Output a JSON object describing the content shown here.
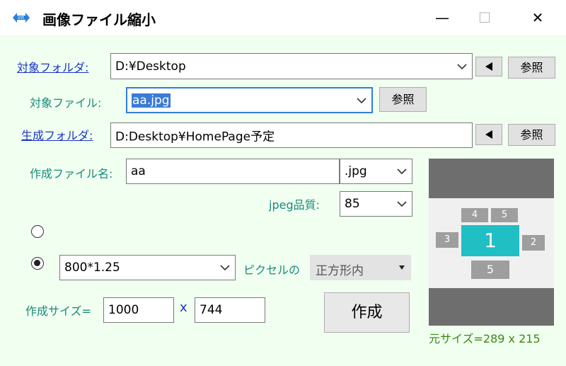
{
  "window": {
    "title": "画像ファイル縮小",
    "minimize": "—",
    "maximize": "☐",
    "close": "✕"
  },
  "target_folder": {
    "label": "対象フォルダ:",
    "value": "D:¥Desktop",
    "button": "参照"
  },
  "target_file": {
    "label": "対象ファイル:",
    "value": "aa.jpg",
    "button": "参照"
  },
  "output_folder": {
    "label": "生成フォルダ:",
    "value": "D:Desktop¥HomePage予定",
    "button": "参照"
  },
  "output_name": {
    "label": "作成ファイル名:",
    "value": "aa",
    "ext": ".jpg"
  },
  "jpeg_quality": {
    "label": "jpeg品質:",
    "value": "85"
  },
  "resize_option": {
    "value": "800*1.25",
    "pixel_label": "ピクセルの",
    "mode": "正方形内"
  },
  "create_size": {
    "label": "作成サイズ=",
    "width": "1000",
    "times": "x",
    "height": "744"
  },
  "create_button": "作成",
  "preview": {
    "boxes": [
      "1",
      "2",
      "3",
      "4",
      "5",
      "5"
    ]
  },
  "original_size": "元サイズ=289 x 215",
  "colors": {
    "background": "#f0fff0",
    "link": "#1a35c8",
    "label_teal": "#1a8a7a",
    "preview_accent": "#1fbfc4",
    "orig_size": "#3a8a10"
  }
}
